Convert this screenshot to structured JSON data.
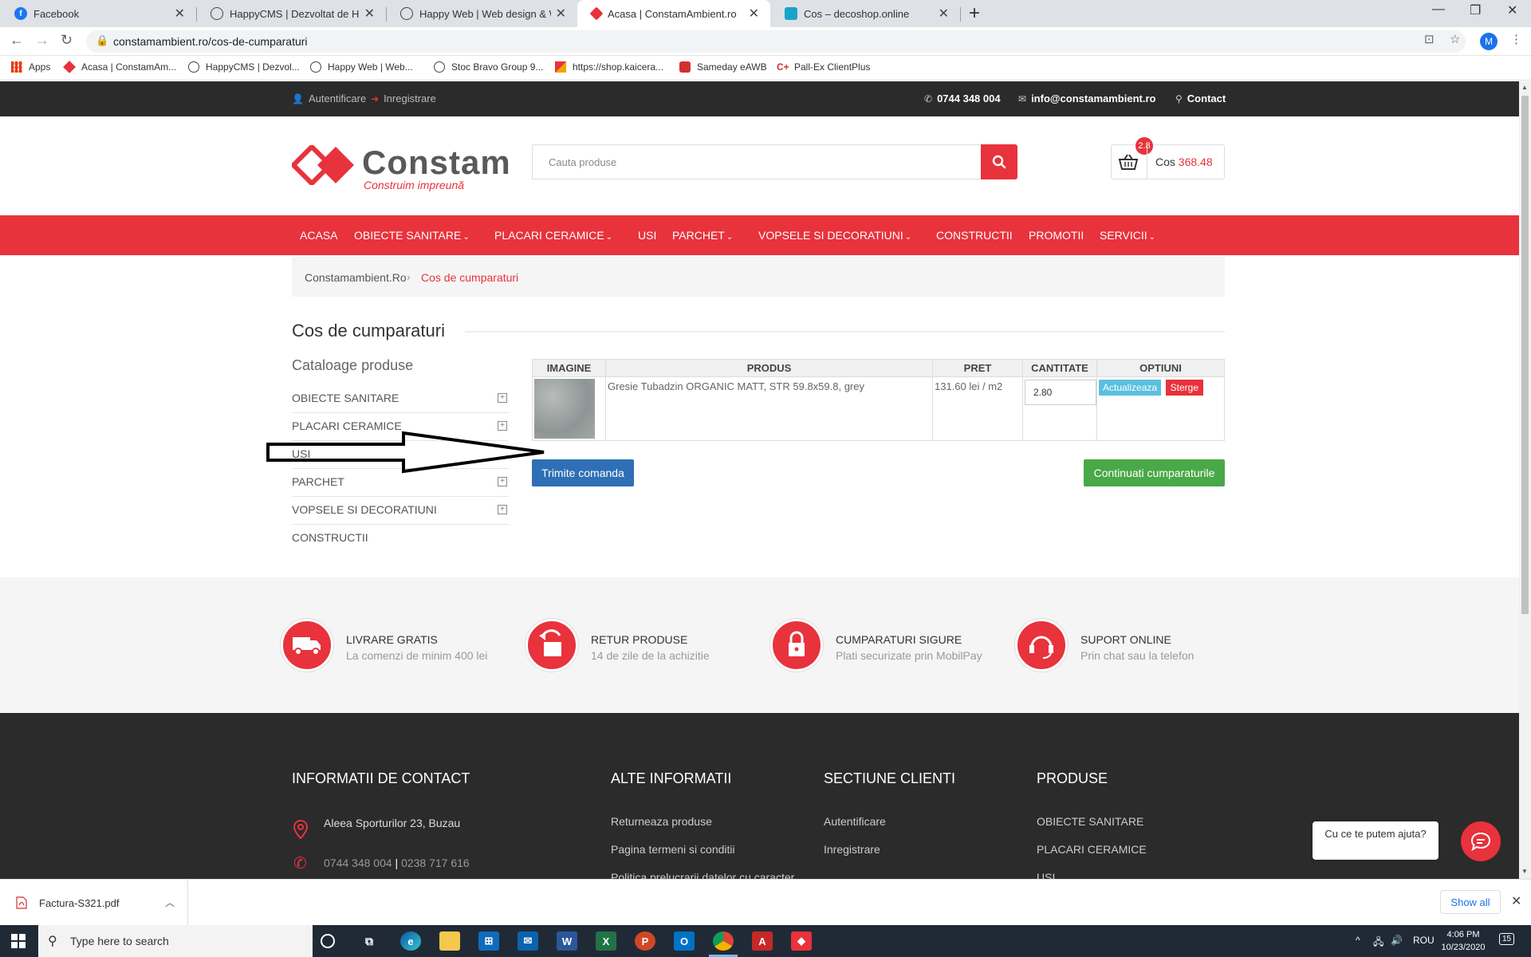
{
  "browser": {
    "tabs": [
      {
        "title": "Facebook",
        "icon": "facebook-icon",
        "color": "#1877f2",
        "active": false
      },
      {
        "title": "HappyCMS | Dezvoltat de Happy",
        "icon": "happy-icon",
        "color": "#333333",
        "active": false
      },
      {
        "title": "Happy Web | Web design & Web",
        "icon": "happy-icon",
        "color": "#333333",
        "active": false
      },
      {
        "title": "Acasa | ConstamAmbient.ro",
        "icon": "constam-icon",
        "color": "#e8323c",
        "active": true
      },
      {
        "title": "Cos – decoshop.online",
        "icon": "decoshop-icon",
        "color": "#1aa3c7",
        "active": false
      }
    ],
    "url": "constamambient.ro/cos-de-cumparaturi",
    "profile_initial": "M",
    "bookmarks": [
      {
        "label": "Apps",
        "icon": "apps-grid-icon"
      },
      {
        "label": "Acasa | ConstamAm...",
        "icon": "constam-icon"
      },
      {
        "label": "HappyCMS | Dezvol...",
        "icon": "happy-icon"
      },
      {
        "label": "Happy Web | Web...",
        "icon": "happy-icon"
      },
      {
        "label": "Stoc Bravo Group 9...",
        "icon": "bravo-icon"
      },
      {
        "label": "https://shop.kaicera...",
        "icon": "kaicera-icon"
      },
      {
        "label": "Sameday eAWB",
        "icon": "sameday-icon"
      },
      {
        "label": "Pall-Ex ClientPlus",
        "icon": "pallex-icon"
      }
    ]
  },
  "site": {
    "accent_color": "#e8323c",
    "topbar": {
      "login": "Autentificare",
      "register": "Inregistrare",
      "phone": "0744 348 004",
      "email": "info@constamambient.ro",
      "contact": "Contact"
    },
    "logo": {
      "word": "Constam",
      "tagline": "Construim impreună"
    },
    "search_placeholder": "Cauta produse",
    "cart": {
      "badge": "2.8",
      "label": "Cos",
      "amount": "368.48"
    },
    "nav": [
      {
        "label": "ACASA",
        "dropdown": false
      },
      {
        "label": "OBIECTE SANITARE",
        "dropdown": true
      },
      {
        "label": "PLACARI CERAMICE",
        "dropdown": true
      },
      {
        "label": "USI",
        "dropdown": false
      },
      {
        "label": "PARCHET",
        "dropdown": true
      },
      {
        "label": "VOPSELE SI DECORATIUNI",
        "dropdown": true
      },
      {
        "label": "CONSTRUCTII",
        "dropdown": false
      },
      {
        "label": "PROMOTII",
        "dropdown": false
      },
      {
        "label": "SERVICII",
        "dropdown": true
      }
    ],
    "breadcrumb": {
      "home": "Constamambient.Ro",
      "current": "Cos de cumparaturi"
    },
    "page_title": "Cos de cumparaturi",
    "sidebar": {
      "title": "Cataloage produse",
      "items": [
        {
          "label": "OBIECTE SANITARE",
          "expandable": true
        },
        {
          "label": "PLACARI CERAMICE",
          "expandable": true
        },
        {
          "label": "USI",
          "expandable": false
        },
        {
          "label": "PARCHET",
          "expandable": true
        },
        {
          "label": "VOPSELE SI DECORATIUNI",
          "expandable": true
        },
        {
          "label": "CONSTRUCTII",
          "expandable": false
        }
      ]
    },
    "cart_table": {
      "headers": [
        "IMAGINE",
        "PRODUS",
        "PRET",
        "CANTITATE",
        "OPTIUNI"
      ],
      "rows": [
        {
          "product": "Gresie Tubadzin ORGANIC MATT, STR 59.8x59.8, grey",
          "price": "131.60 lei / m2",
          "quantity": "2.80",
          "update_label": "Actualizeaza",
          "delete_label": "Sterge"
        }
      ]
    },
    "buttons": {
      "send_order": "Trimite comanda",
      "continue_shopping": "Continuati cumparaturile"
    },
    "features": [
      {
        "title": "LIVRARE GRATIS",
        "subtitle": "La comenzi de minim 400 lei",
        "icon": "truck-icon"
      },
      {
        "title": "RETUR PRODUSE",
        "subtitle": "14 de zile de la achizitie",
        "icon": "return-icon"
      },
      {
        "title": "CUMPARATURI SIGURE",
        "subtitle": "Plati securizate prin MobilPay",
        "icon": "lock-icon"
      },
      {
        "title": "SUPORT ONLINE",
        "subtitle": "Prin chat sau la telefon",
        "icon": "headset-icon"
      }
    ],
    "footer": {
      "contact": {
        "heading": "INFORMATII DE CONTACT",
        "address": "Aleea Sporturilor 23, Buzau",
        "phone1": "0744 348 004",
        "phone_sep": "|",
        "phone2": "0238 717 616"
      },
      "other": {
        "heading": "ALTE INFORMATII",
        "links": [
          "Returneaza produse",
          "Pagina termeni si conditii",
          "Politica prelucrarii datelor cu caracter"
        ]
      },
      "client": {
        "heading": "SECTIUNE CLIENTI",
        "links": [
          "Autentificare",
          "Inregistrare"
        ]
      },
      "products": {
        "heading": "PRODUSE",
        "links": [
          "OBIECTE SANITARE",
          "PLACARI CERAMICE",
          "USI"
        ]
      }
    },
    "chat": {
      "prompt": "Cu ce te putem ajuta?"
    }
  },
  "downloads": {
    "file": "Factura-S321.pdf",
    "show_all": "Show all"
  },
  "taskbar": {
    "search_placeholder": "Type here to search",
    "language": "ROU",
    "time": "4:06 PM",
    "date": "10/23/2020",
    "notifications": "15"
  }
}
